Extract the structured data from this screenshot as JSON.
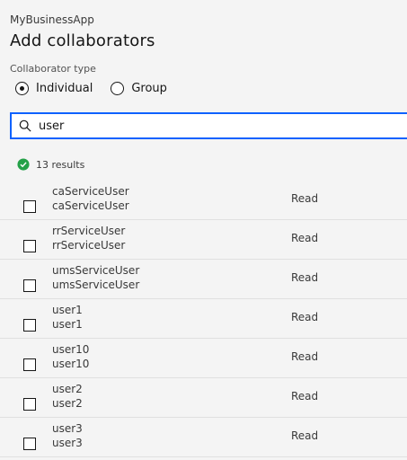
{
  "header": {
    "app_name": "MyBusinessApp",
    "title": "Add collaborators"
  },
  "collaborator_type": {
    "label": "Collaborator type",
    "options": [
      {
        "label": "Individual",
        "checked": true
      },
      {
        "label": "Group",
        "checked": false
      }
    ]
  },
  "search": {
    "value": "user",
    "icon": "search-icon"
  },
  "results": {
    "icon": "checkmark-filled-icon",
    "text": "13 results",
    "status_color": "#24a148"
  },
  "accent_color": "#0f62fe",
  "rows": [
    {
      "name": "caServiceUser",
      "subname": "caServiceUser",
      "role": "Read"
    },
    {
      "name": "rrServiceUser",
      "subname": "rrServiceUser",
      "role": "Read"
    },
    {
      "name": "umsServiceUser",
      "subname": "umsServiceUser",
      "role": "Read"
    },
    {
      "name": "user1",
      "subname": "user1",
      "role": "Read"
    },
    {
      "name": "user10",
      "subname": "user10",
      "role": "Read"
    },
    {
      "name": "user2",
      "subname": "user2",
      "role": "Read"
    },
    {
      "name": "user3",
      "subname": "user3",
      "role": "Read"
    }
  ]
}
